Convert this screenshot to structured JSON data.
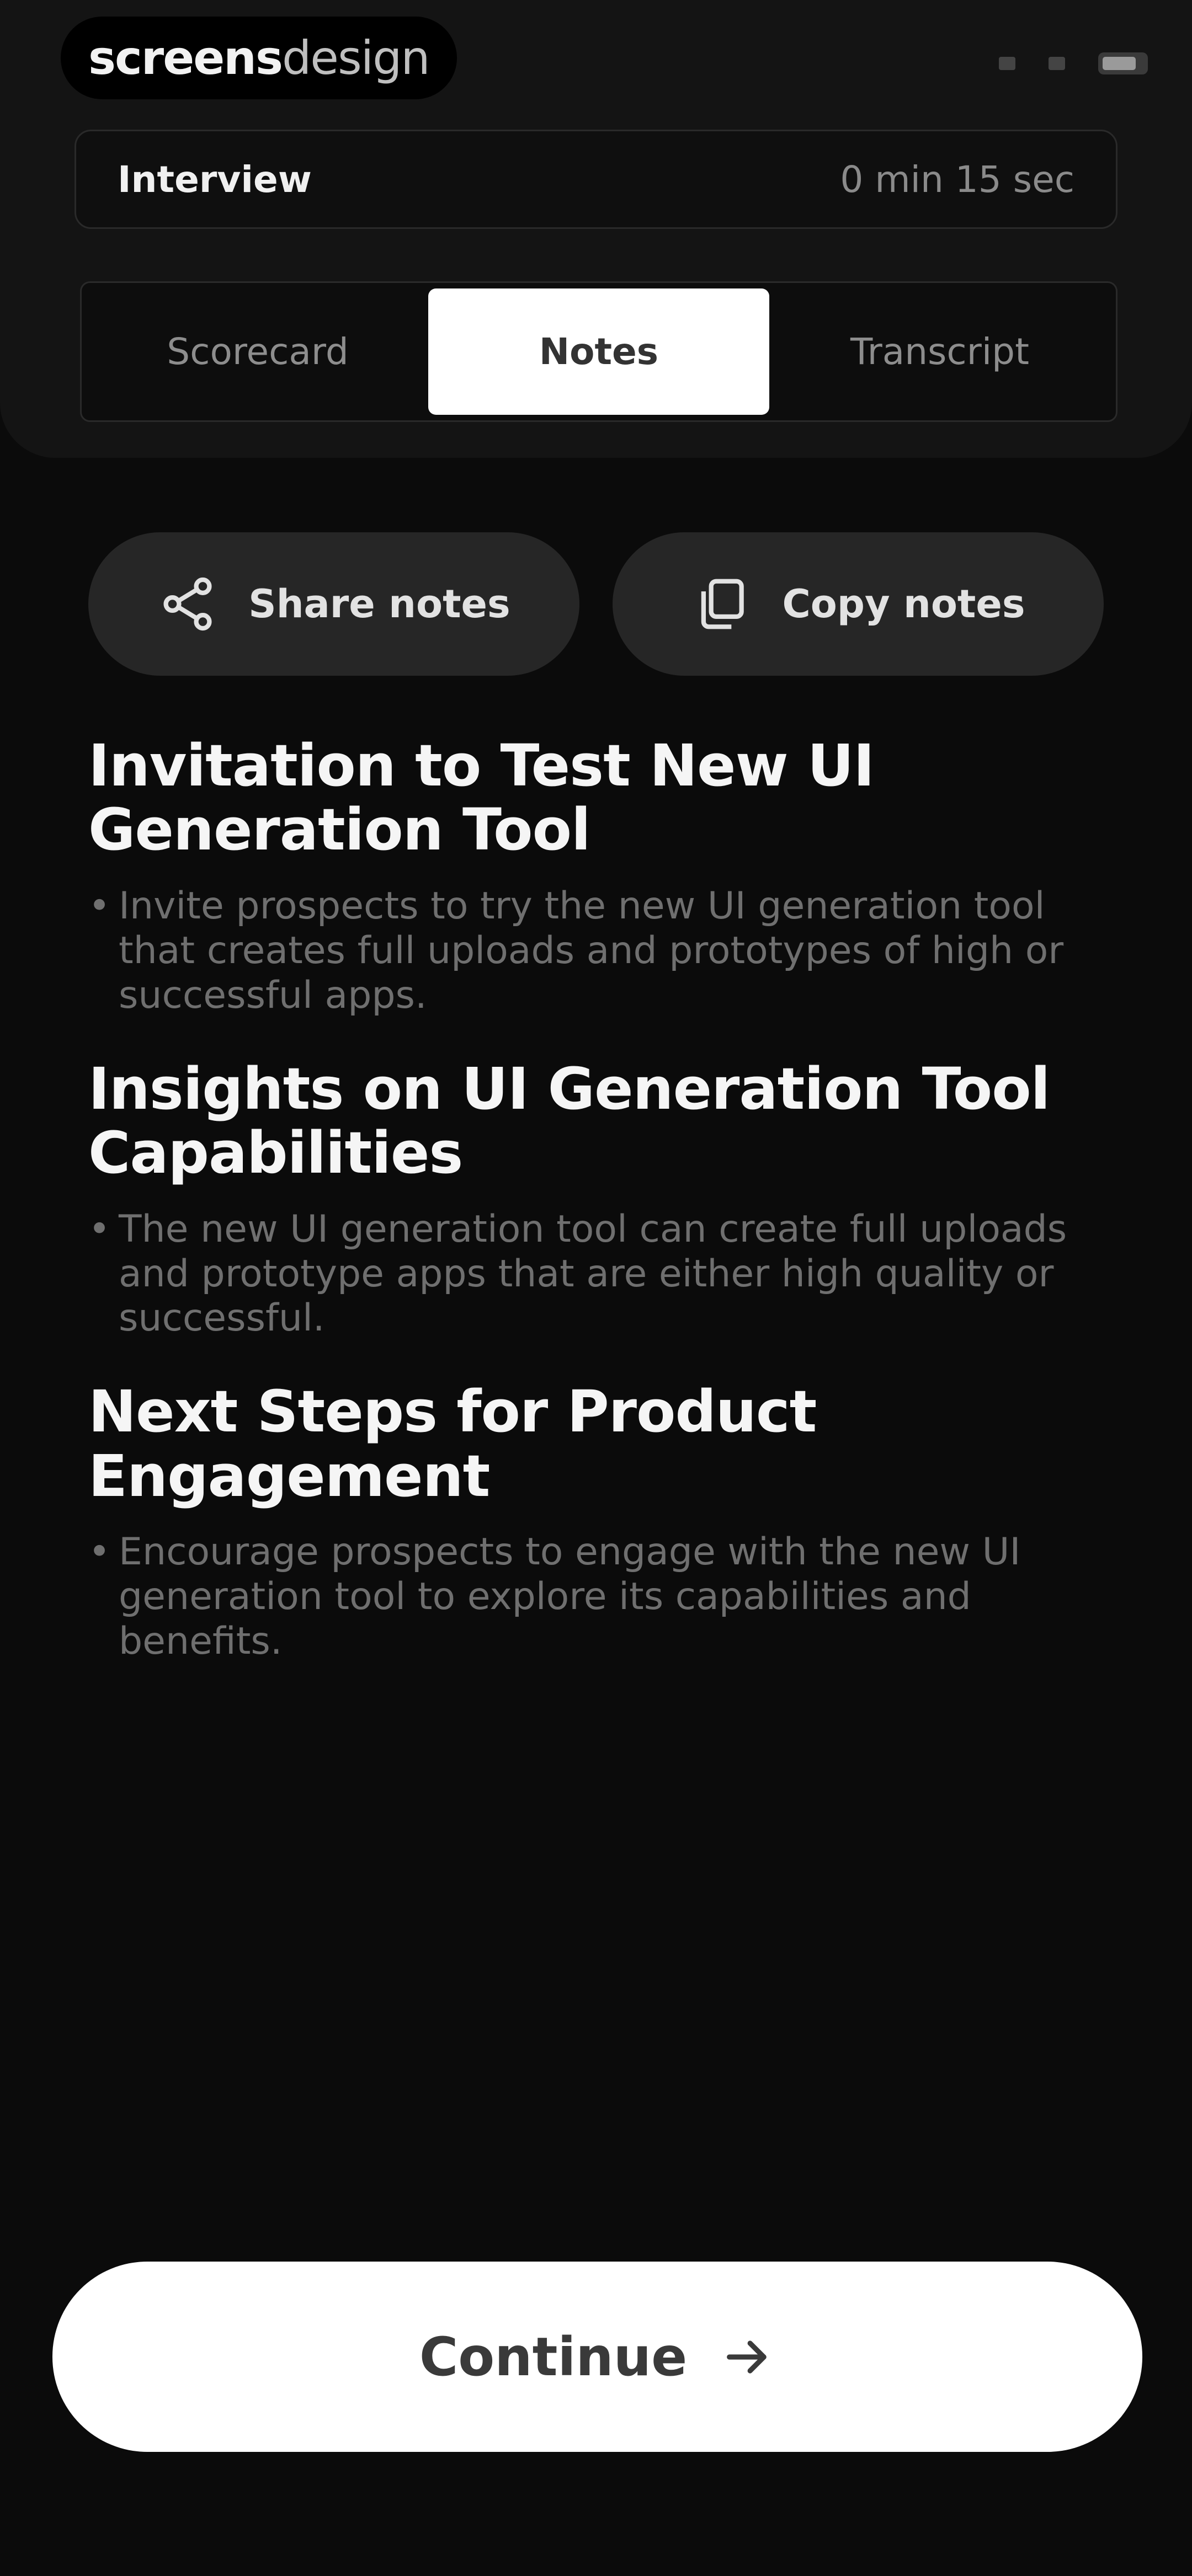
{
  "brand": {
    "bold": "screens",
    "light": "design"
  },
  "header": {
    "title": "Interview",
    "timer": "0 min 15 sec"
  },
  "tabs": [
    {
      "label": "Scorecard",
      "active": false
    },
    {
      "label": "Notes",
      "active": true
    },
    {
      "label": "Transcript",
      "active": false
    }
  ],
  "actions": {
    "share_label": "Share notes",
    "copy_label": "Copy notes"
  },
  "notes": [
    {
      "heading": "Invitation to Test New UI Generation Tool",
      "bullets": [
        "Invite prospects to try the new UI generation tool that creates full uploads and prototypes of high or successful apps."
      ]
    },
    {
      "heading": "Insights on UI Generation Tool Capabilities",
      "bullets": [
        "The new UI generation tool can create full uploads and prototype apps that are either high quality or successful."
      ]
    },
    {
      "heading": "Next Steps for Product Engagement",
      "bullets": [
        "Encourage prospects to engage with the new UI generation tool to explore its capabilities and benefits."
      ]
    }
  ],
  "continue": {
    "label": "Continue"
  },
  "icons": {
    "share": "share-icon",
    "copy": "copy-icon",
    "arrow": "arrow-right-icon"
  },
  "colors": {
    "background": "#0b0b0b",
    "card": "#141414",
    "button": "#262626",
    "primary": "#ffffff"
  }
}
